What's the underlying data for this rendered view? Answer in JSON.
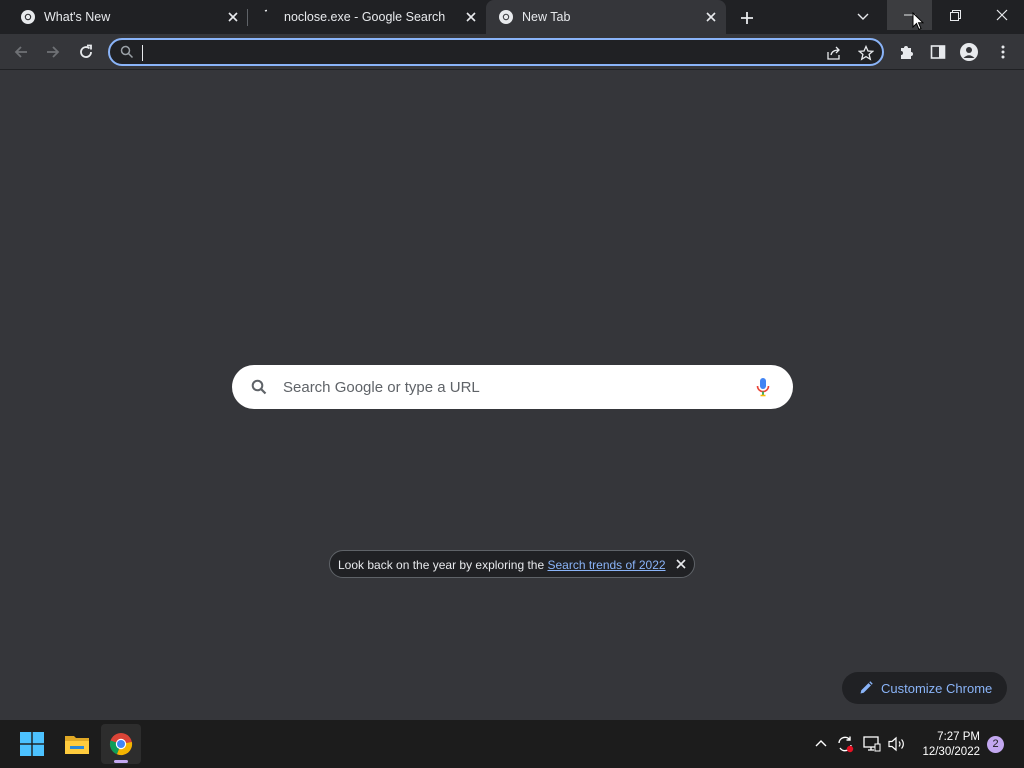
{
  "tabs": [
    {
      "title": "What's New",
      "favicon": "chrome-icon"
    },
    {
      "title": "noclose.exe - Google Search",
      "favicon": "loading-icon"
    },
    {
      "title": "New Tab",
      "favicon": "chrome-icon",
      "active": true
    }
  ],
  "omnibox": {
    "value": "",
    "placeholder": ""
  },
  "ntp": {
    "search_placeholder": "Search Google or type a URL",
    "promo_text": "Look back on the year by exploring the ",
    "promo_link": "Search trends of 2022",
    "customize_label": "Customize Chrome"
  },
  "taskbar": {
    "time": "7:27 PM",
    "date": "12/30/2022",
    "notification_count": "2"
  },
  "colors": {
    "frame": "#202124",
    "page": "#35363a",
    "accent": "#8ab4f8",
    "taskbar": "#1c1c1c"
  }
}
